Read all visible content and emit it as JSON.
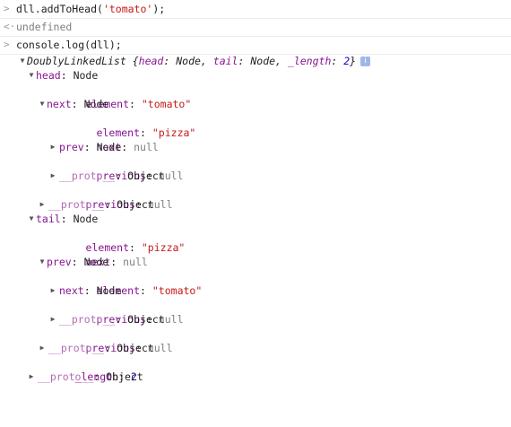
{
  "console": {
    "input_prompt": ">",
    "result_prompt": "<·",
    "entries": [
      {
        "command": "dll.addToHead(",
        "arg": "'tomato'",
        "close": ");"
      },
      {
        "result": "undefined"
      },
      {
        "command": "console.log(dll);"
      }
    ]
  },
  "icons": {
    "input": "chevron-right-icon",
    "result": "return-arrow-icon",
    "expanded": "triangle-down-icon",
    "collapsed": "triangle-right-icon",
    "info": "info-icon"
  },
  "colors": {
    "key": "#881391",
    "string": "#c41a16",
    "null": "#808080",
    "number": "#1c00cf",
    "proto": "#b46bb5"
  },
  "tree": {
    "summary": {
      "class_name": "DoublyLinkedList",
      "open": "{",
      "k1": "head",
      "v1": "Node",
      "k2": "tail",
      "v2": "Node",
      "k3": "_length",
      "v3": "2",
      "close": "}",
      "info": "i"
    },
    "head": {
      "key": "head",
      "value": "Node",
      "element": {
        "key": "element",
        "value": "\"tomato\""
      },
      "next": {
        "key": "next",
        "value": "Node",
        "element": {
          "key": "element",
          "value": "\"pizza\""
        },
        "next": {
          "key": "next",
          "value": "null"
        },
        "prev": {
          "key": "prev",
          "value": "Node"
        },
        "previous": {
          "key": "previous",
          "value": "null"
        },
        "proto": {
          "key": "__proto__",
          "value": "Object"
        }
      },
      "previous": {
        "key": "previous",
        "value": "null"
      },
      "proto": {
        "key": "__proto__",
        "value": "Object"
      }
    },
    "tail": {
      "key": "tail",
      "value": "Node",
      "element": {
        "key": "element",
        "value": "\"pizza\""
      },
      "next": {
        "key": "next",
        "value": "null"
      },
      "prev": {
        "key": "prev",
        "value": "Node",
        "element": {
          "key": "element",
          "value": "\"tomato\""
        },
        "next": {
          "key": "next",
          "value": "Node"
        },
        "previous": {
          "key": "previous",
          "value": "null"
        },
        "proto": {
          "key": "__proto__",
          "value": "Object"
        }
      },
      "previous": {
        "key": "previous",
        "value": "null"
      },
      "proto": {
        "key": "__proto__",
        "value": "Object"
      }
    },
    "length": {
      "key": "_length",
      "value": "2"
    },
    "proto": {
      "key": "__proto__",
      "value": "Object"
    }
  }
}
